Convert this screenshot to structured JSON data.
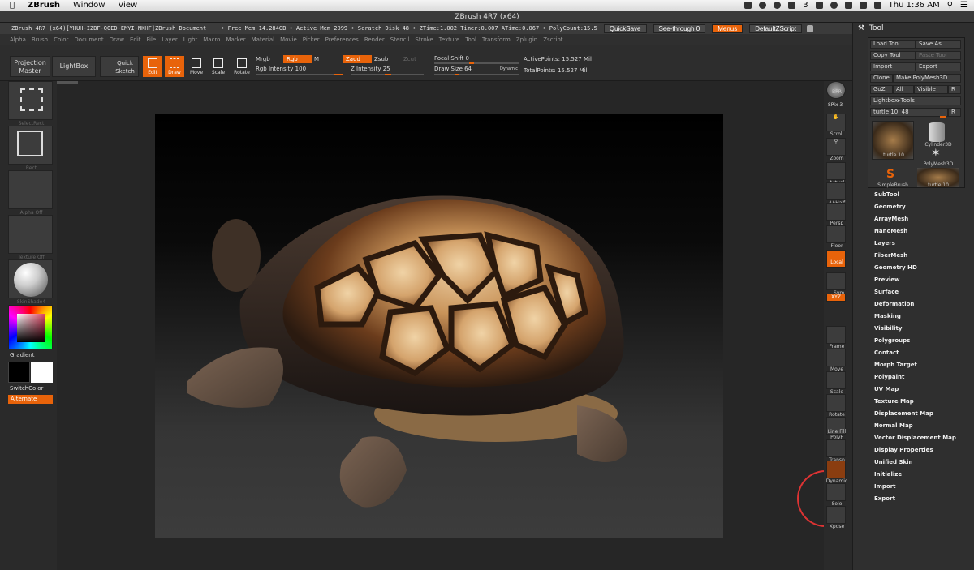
{
  "menubar": {
    "app": "ZBrush",
    "menus": [
      "Window",
      "View"
    ],
    "clock": "Thu 1:36 AM",
    "badge": "3"
  },
  "titlebar": {
    "title": "ZBrush 4R7 (x64)"
  },
  "infostrip": {
    "doc": "ZBrush 4R7 (x64)[YHUH-IZBF-QOED-EMYI-NKHF]ZBrush Document",
    "mem": "• Free Mem 14.284GB • Active Mem 2099 • Scratch Disk 48 • ZTime:1.002 Timer:0.007 ATime:0.067 • PolyCount:15.5",
    "quicksave": "QuickSave",
    "seethrough": "See-through",
    "seethrough_val": "0",
    "menus": "Menus",
    "zscript": "DefaultZScript"
  },
  "menusrow": [
    "Alpha",
    "Brush",
    "Color",
    "Document",
    "Draw",
    "Edit",
    "File",
    "Layer",
    "Light",
    "Macro",
    "Marker",
    "Material",
    "Movie",
    "Picker",
    "Preferences",
    "Render",
    "Stencil",
    "Stroke",
    "Texture",
    "Tool",
    "Transform",
    "Zplugin",
    "Zscript"
  ],
  "shelf": {
    "projection": "Projection Master",
    "lightbox": "LightBox",
    "quicksketch": "Quick Sketch",
    "edit": "Edit",
    "draw": "Draw",
    "move": "Move",
    "scale": "Scale",
    "rotate": "Rotate",
    "mrgb": "Mrgb",
    "rgb": "Rgb",
    "m": "M",
    "rgb_intensity": "Rgb Intensity 100",
    "zadd": "Zadd",
    "zsub": "Zsub",
    "zcut": "Zcut",
    "z_intensity": "Z Intensity 25",
    "focal_shift": "Focal Shift 0",
    "draw_size": "Draw Size 64",
    "dynamic": "Dynamic",
    "active_points": "ActivePoints: 15.527 Mil",
    "total_points": "TotalPoints: 15.527 Mil"
  },
  "leftbar": {
    "selectrect": "SelectRect",
    "rect": "Rect",
    "alpha": "Alpha Off",
    "texture": "Texture Off",
    "material": "SkinShade4",
    "gradient": "Gradient",
    "switchcolor": "SwitchColor",
    "alternate": "Alternate"
  },
  "rightbar": [
    "BPR",
    "SPix 3",
    "Scroll",
    "Zoom",
    "Actual",
    "AAHalf",
    "Persp",
    "Floor",
    "Local",
    "L.Sym",
    "XYZ",
    "Frame",
    "Move",
    "Scale",
    "Rotate",
    "Line Fill PolyF",
    "Transp",
    "Dynamic",
    "Solo",
    "Xpose"
  ],
  "toolpanel": {
    "title": "Tool",
    "load": "Load Tool",
    "save": "Save As",
    "copy": "Copy Tool",
    "paste": "Paste Tool",
    "import": "Import",
    "export": "Export",
    "clone": "Clone",
    "make": "Make PolyMesh3D",
    "goz": "GoZ",
    "all": "All",
    "visible": "Visible",
    "r": "R",
    "lightbox_tools": "Lightbox▸Tools",
    "current": "turtle 10. 48",
    "r2": "R",
    "thumbs": [
      "turtle 10",
      "Cylinder3D",
      "PolyMesh3D",
      "SimpleBrush",
      "turtle 10"
    ],
    "subpalettes": [
      "SubTool",
      "Geometry",
      "ArrayMesh",
      "NanoMesh",
      "Layers",
      "FiberMesh",
      "Geometry HD",
      "Preview",
      "Surface",
      "Deformation",
      "Masking",
      "Visibility",
      "Polygroups",
      "Contact",
      "Morph Target",
      "Polypaint",
      "UV Map",
      "Texture Map",
      "Displacement Map",
      "Normal Map",
      "Vector Displacement Map",
      "Display Properties",
      "Unified Skin",
      "Initialize",
      "Import",
      "Export"
    ]
  },
  "colors": {
    "accent": "#e8630a",
    "bg": "#2b2b2b"
  }
}
